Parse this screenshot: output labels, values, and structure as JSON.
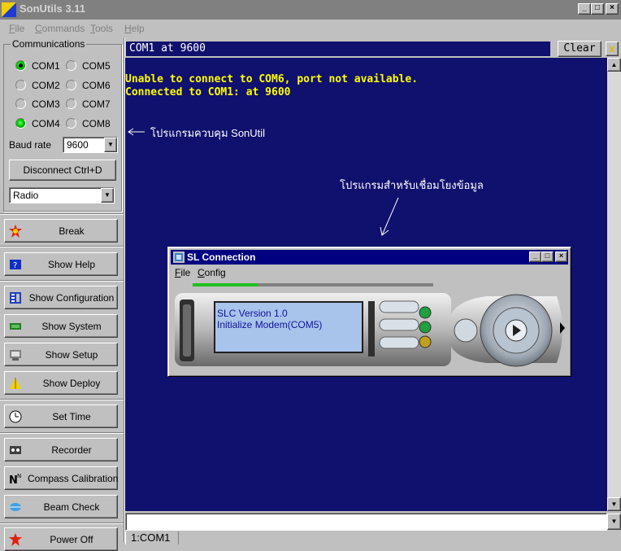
{
  "app": {
    "title": "SonUtils 3.11"
  },
  "menu": [
    {
      "label": "File",
      "mnemonic": "F",
      "rest": "ile"
    },
    {
      "label": "Commands",
      "mnemonic": "C",
      "rest": "ommands"
    },
    {
      "label": "Tools",
      "mnemonic": "T",
      "rest": "ools"
    },
    {
      "label": "Help",
      "mnemonic": "H",
      "rest": "elp"
    }
  ],
  "communications": {
    "legend": "Communications",
    "ports": [
      {
        "label": "COM1",
        "state": "connected"
      },
      {
        "label": "COM5",
        "state": "off"
      },
      {
        "label": "COM2",
        "state": "off"
      },
      {
        "label": "COM6",
        "state": "off"
      },
      {
        "label": "COM3",
        "state": "off"
      },
      {
        "label": "COM7",
        "state": "off"
      },
      {
        "label": "COM4",
        "state": "active"
      },
      {
        "label": "COM8",
        "state": "off"
      }
    ],
    "baud_label": "Baud rate",
    "baud_value": "9600",
    "disconnect_label": "Disconnect    Ctrl+D",
    "device_value": "Radio"
  },
  "side_buttons": {
    "break": "Break",
    "show_help": "Show Help",
    "show_configuration": "Show Configuration",
    "show_system": "Show System",
    "show_setup": "Show Setup",
    "show_deploy": "Show Deploy",
    "set_time": "Set Time",
    "recorder": "Recorder",
    "compass_calibration": "Compass Calibration",
    "beam_check": "Beam Check",
    "power_off": "Power Off"
  },
  "terminal": {
    "port_label": "COM1 at 9600",
    "clear_label": "Clear",
    "close_label": "x",
    "lines": [
      "Unable to connect to COM6, port not available.",
      "Connected to COM1: at 9600"
    ],
    "annotation_sonutil": "โปรแกรมควบคุม SonUtil",
    "annotation_slc": "โปรแกรมสำหรับเชื่อมโยงข้อมูล",
    "status_tab": "1:COM1"
  },
  "sl_connection": {
    "title": "SL Connection",
    "menu": [
      {
        "mnemonic": "F",
        "rest": "ile"
      },
      {
        "mnemonic": "C",
        "rest": "onfig"
      }
    ],
    "lcd_lines": [
      "SLC Version 1.0",
      "Initialize Modem(COM5)"
    ]
  },
  "colors": {
    "terminal_bg": "#10106e",
    "terminal_text": "#ffff00",
    "led_active": "#00cc00",
    "sl_lcd": "#a8c4ea"
  }
}
